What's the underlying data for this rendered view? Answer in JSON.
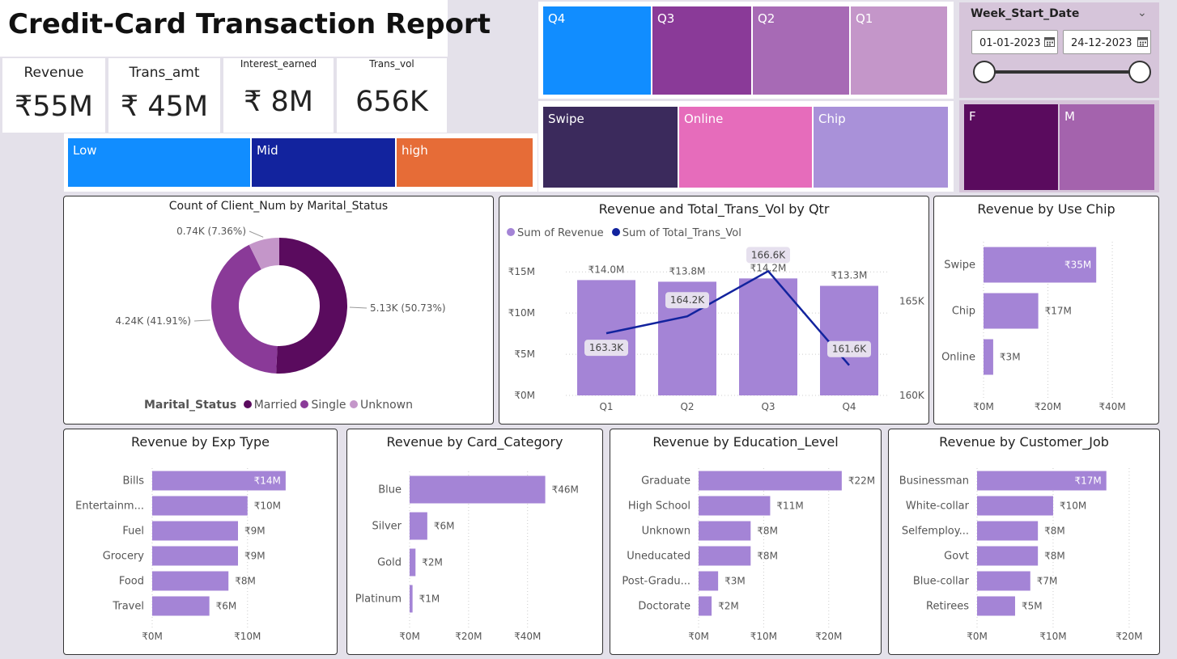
{
  "header": {
    "title": "Credit-Card Transaction Report"
  },
  "kpis": [
    {
      "label": "Revenue",
      "value": "₹55M"
    },
    {
      "label": "Trans_amt",
      "value": "₹ 45M"
    },
    {
      "label": "Interest_earned",
      "value": "₹ 8M"
    },
    {
      "label": "Trans_vol",
      "value": "656K"
    }
  ],
  "slicers": {
    "income": [
      {
        "label": "Low",
        "color": "#118dff"
      },
      {
        "label": "Mid",
        "color": "#12239e"
      },
      {
        "label": "high",
        "color": "#e66c37"
      }
    ],
    "quarter": [
      {
        "label": "Q4",
        "color": "#118dff"
      },
      {
        "label": "Q3",
        "color": "#8a3a98"
      },
      {
        "label": "Q2",
        "color": "#a76ab5"
      },
      {
        "label": "Q1",
        "color": "#c496c9"
      }
    ],
    "card_type": [
      {
        "label": "Swipe",
        "color": "#3b2a5c"
      },
      {
        "label": "Online",
        "color": "#e66cbb"
      },
      {
        "label": "Chip",
        "color": "#a991d9"
      }
    ],
    "gender": [
      {
        "label": "F",
        "color": "#5a0b5e"
      },
      {
        "label": "M",
        "color": "#a463ad"
      }
    ]
  },
  "week_filter": {
    "title": "Week_Start_Date",
    "start": "01-01-2023",
    "end": "24-12-2023",
    "chevron_icon": "chevron-down-icon",
    "calendar_icon": "calendar-icon",
    "range_start": 0,
    "range_end": 1
  },
  "donut": {
    "title": "Count of Client_Num by Marital_Status",
    "legend_title": "Marital_Status",
    "slices": [
      {
        "name": "Married",
        "value": 5.13,
        "label": "5.13K (50.73%)",
        "color": "#5a0b5e"
      },
      {
        "name": "Single",
        "value": 4.24,
        "label": "4.24K (41.91%)",
        "color": "#8a3a98"
      },
      {
        "name": "Unknown",
        "value": 0.74,
        "label": "0.74K (7.36%)",
        "color": "#c496c9"
      }
    ]
  },
  "combo": {
    "title": "Revenue and Total_Trans_Vol by Qtr",
    "legend": [
      {
        "name": "Sum of Revenue",
        "color": "#a484d6"
      },
      {
        "name": "Sum of Total_Trans_Vol",
        "color": "#12239e"
      }
    ],
    "categories": [
      "Q1",
      "Q2",
      "Q3",
      "Q4"
    ],
    "revenue": [
      14.0,
      13.8,
      14.2,
      13.3
    ],
    "revenue_labels": [
      "₹14.0M",
      "₹13.8M",
      "₹14.2M",
      "₹13.3M"
    ],
    "volume": [
      163.3,
      164.2,
      166.6,
      161.6
    ],
    "volume_labels": [
      "163.3K",
      "164.2K",
      "166.6K",
      "161.6K"
    ],
    "left_ticks": [
      "₹0M",
      "₹5M",
      "₹10M",
      "₹15M"
    ],
    "left_tick_values": [
      0,
      5,
      10,
      15
    ],
    "right_ticks": [
      "160K",
      "165K"
    ],
    "right_tick_values": [
      160,
      165
    ],
    "left_range": [
      0,
      16
    ],
    "right_range": [
      160,
      167
    ]
  },
  "usechip": {
    "title": "Revenue by Use Chip",
    "categories": [
      "Swipe",
      "Chip",
      "Online"
    ],
    "values": [
      35,
      17,
      3
    ],
    "labels": [
      "₹35M",
      "₹17M",
      "₹3M"
    ],
    "ticks": [
      "₹0M",
      "₹20M",
      "₹40M"
    ],
    "tick_values": [
      0,
      20,
      40
    ],
    "xmax": 44
  },
  "exptype": {
    "title": "Revenue by Exp Type",
    "categories": [
      "Bills",
      "Entertainm...",
      "Fuel",
      "Grocery",
      "Food",
      "Travel"
    ],
    "values": [
      14,
      10,
      9,
      9,
      8,
      6
    ],
    "labels": [
      "₹14M",
      "₹10M",
      "₹9M",
      "₹9M",
      "₹8M",
      "₹6M"
    ],
    "ticks": [
      "₹0M",
      "₹10M"
    ],
    "tick_values": [
      0,
      10
    ],
    "xmax": 18
  },
  "cardcat": {
    "title": "Revenue by Card_Category",
    "categories": [
      "Blue",
      "Silver",
      "Gold",
      "Platinum"
    ],
    "values": [
      46,
      6,
      2,
      1
    ],
    "labels": [
      "₹46M",
      "₹6M",
      "₹2M",
      "₹1M"
    ],
    "ticks": [
      "₹0M",
      "₹20M",
      "₹40M"
    ],
    "tick_values": [
      0,
      20,
      40
    ],
    "xmax": 56
  },
  "education": {
    "title": "Revenue by Education_Level",
    "categories": [
      "Graduate",
      "High School",
      "Unknown",
      "Uneducated",
      "Post-Gradu...",
      "Doctorate"
    ],
    "values": [
      22,
      11,
      8,
      8,
      3,
      2
    ],
    "labels": [
      "₹22M",
      "₹11M",
      "₹8M",
      "₹8M",
      "₹3M",
      "₹2M"
    ],
    "ticks": [
      "₹0M",
      "₹10M",
      "₹20M"
    ],
    "tick_values": [
      0,
      10,
      20
    ],
    "xmax": 26
  },
  "job": {
    "title": "Revenue by Customer_Job",
    "categories": [
      "Businessman",
      "White-collar",
      "Selfemploy...",
      "Govt",
      "Blue-collar",
      "Retirees"
    ],
    "values": [
      17,
      10,
      8,
      8,
      7,
      5
    ],
    "labels": [
      "₹17M",
      "₹10M",
      "₹8M",
      "₹8M",
      "₹7M",
      "₹5M"
    ],
    "ticks": [
      "₹0M",
      "₹10M",
      "₹20M"
    ],
    "tick_values": [
      0,
      10,
      20
    ],
    "xmax": 21.5
  },
  "chart_data": [
    {
      "type": "pie",
      "title": "Count of Client_Num by Marital_Status",
      "categories": [
        "Married",
        "Single",
        "Unknown"
      ],
      "values": [
        5.13,
        4.24,
        0.74
      ]
    },
    {
      "type": "bar",
      "title": "Revenue and Total_Trans_Vol by Qtr",
      "categories": [
        "Q1",
        "Q2",
        "Q3",
        "Q4"
      ],
      "series": [
        {
          "name": "Sum of Revenue",
          "values": [
            14.0,
            13.8,
            14.2,
            13.3
          ]
        },
        {
          "name": "Sum of Total_Trans_Vol",
          "values": [
            163.3,
            164.2,
            166.6,
            161.6
          ]
        }
      ]
    },
    {
      "type": "bar",
      "title": "Revenue by Use Chip",
      "categories": [
        "Swipe",
        "Chip",
        "Online"
      ],
      "values": [
        35,
        17,
        3
      ]
    },
    {
      "type": "bar",
      "title": "Revenue by Exp Type",
      "categories": [
        "Bills",
        "Entertainm...",
        "Fuel",
        "Grocery",
        "Food",
        "Travel"
      ],
      "values": [
        14,
        10,
        9,
        9,
        8,
        6
      ]
    },
    {
      "type": "bar",
      "title": "Revenue by Card_Category",
      "categories": [
        "Blue",
        "Silver",
        "Gold",
        "Platinum"
      ],
      "values": [
        46,
        6,
        2,
        1
      ]
    },
    {
      "type": "bar",
      "title": "Revenue by Education_Level",
      "categories": [
        "Graduate",
        "High School",
        "Unknown",
        "Uneducated",
        "Post-Gradu...",
        "Doctorate"
      ],
      "values": [
        22,
        11,
        8,
        8,
        3,
        2
      ]
    },
    {
      "type": "bar",
      "title": "Revenue by Customer_Job",
      "categories": [
        "Businessman",
        "White-collar",
        "Selfemploy...",
        "Govt",
        "Blue-collar",
        "Retirees"
      ],
      "values": [
        17,
        10,
        8,
        8,
        7,
        5
      ]
    }
  ]
}
